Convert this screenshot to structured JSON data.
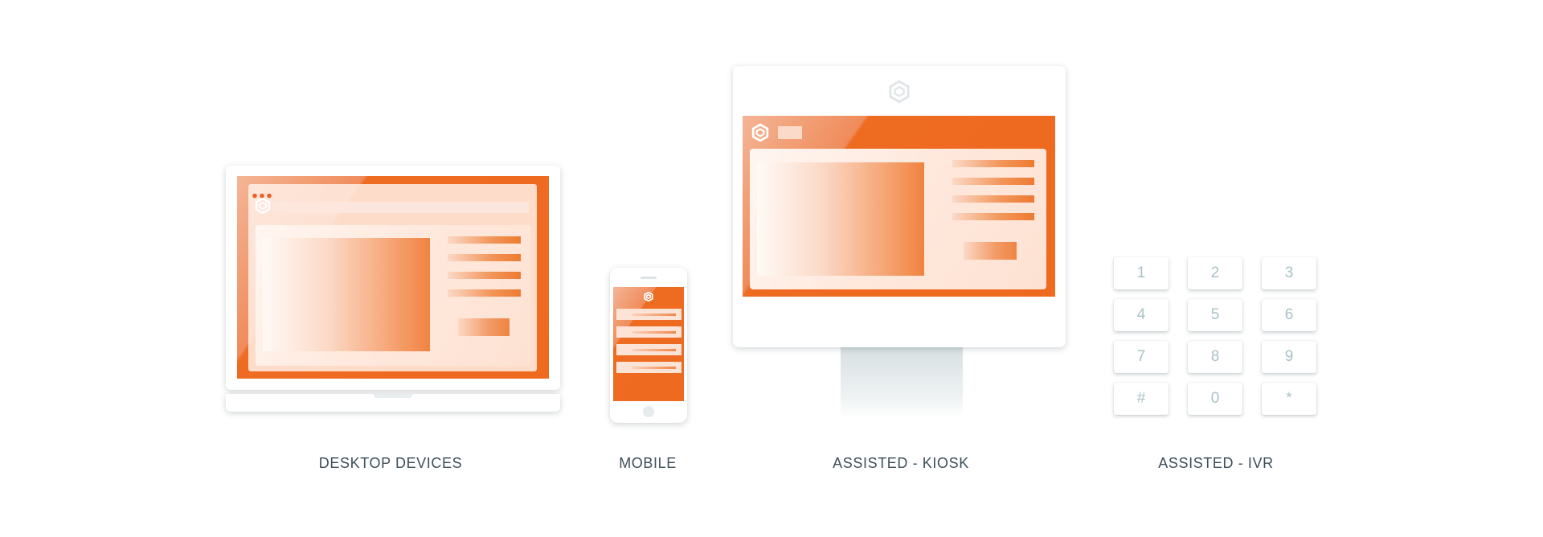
{
  "labels": {
    "desktop": "DESKTOP DEVICES",
    "mobile": "MOBILE",
    "kiosk": "ASSISTED - KIOSK",
    "ivr": "ASSISTED - IVR"
  },
  "keypad": {
    "keys": [
      "1",
      "2",
      "3",
      "4",
      "5",
      "6",
      "7",
      "8",
      "9",
      "#",
      "0",
      "*"
    ]
  },
  "colors": {
    "accent_orange": "#ee6a1f",
    "label_text": "#3d4f59",
    "keypad_text": "#a8c1c6"
  },
  "icons": {
    "brand": "hexagon-logo-icon",
    "window_controls": "window-dots-icon",
    "home_button": "home-button-icon"
  }
}
